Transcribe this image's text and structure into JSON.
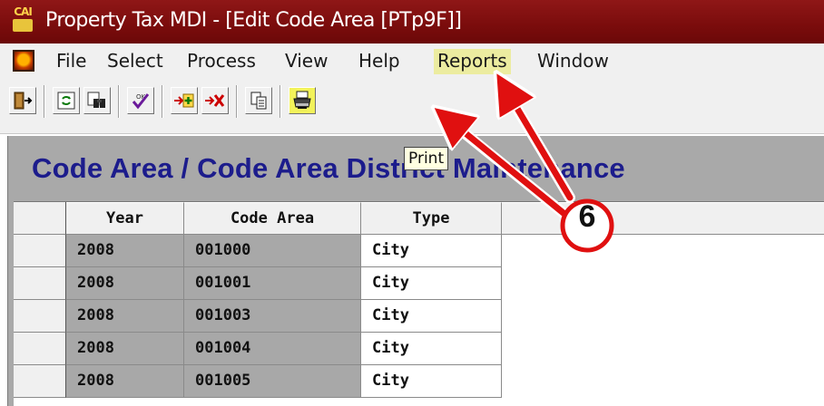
{
  "window": {
    "title": "Property Tax MDI - [Edit Code Area [PTp9F]]",
    "logo_text": "CAI",
    "titlebar_color": "#7a0c0c"
  },
  "menu": {
    "items": [
      {
        "label": "File"
      },
      {
        "label": "Select"
      },
      {
        "label": "Process"
      },
      {
        "label": "View"
      },
      {
        "label": "Help"
      },
      {
        "label": "Reports",
        "highlighted": true
      },
      {
        "label": "Window"
      }
    ],
    "highlight_color": "#ececa0"
  },
  "toolbar": {
    "buttons": [
      {
        "icon": "exit-door-icon"
      },
      {
        "icon": "refresh-icon"
      },
      {
        "icon": "find-binoculars-icon"
      },
      {
        "icon": "ok-check-icon"
      },
      {
        "icon": "add-record-icon"
      },
      {
        "icon": "delete-record-icon"
      },
      {
        "icon": "copy-icon"
      },
      {
        "icon": "printer-icon",
        "highlighted": true
      }
    ],
    "tooltip": "Print"
  },
  "page": {
    "title": "Code Area / Code Area District Maintenance",
    "title_color": "#1c1c8c"
  },
  "grid": {
    "columns": [
      "Year",
      "Code Area",
      "Type"
    ],
    "rows": [
      {
        "year": "2008",
        "code_area": "001000",
        "type": "City"
      },
      {
        "year": "2008",
        "code_area": "001001",
        "type": "City"
      },
      {
        "year": "2008",
        "code_area": "001003",
        "type": "City"
      },
      {
        "year": "2008",
        "code_area": "001004",
        "type": "City"
      },
      {
        "year": "2008",
        "code_area": "001005",
        "type": "City"
      }
    ]
  },
  "annotation": {
    "step_number": "6",
    "arrow_color": "#e01010"
  }
}
